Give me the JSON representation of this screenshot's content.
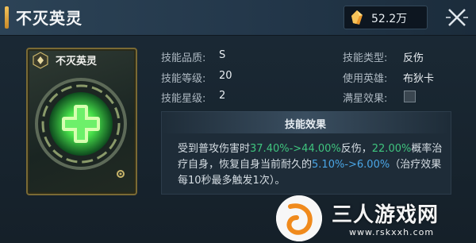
{
  "header": {
    "title": "不灭英灵",
    "currency_amount": "52.2万",
    "currency_icon": "crystal-shard-icon",
    "close_icon": "close-icon"
  },
  "card": {
    "title": "不灭英灵",
    "emblem_icon": "green-cross-shield-icon",
    "corner_icon": "skill-type-icon",
    "gear_icon": "gear-icon",
    "frame_color": "#7a6a34",
    "emblem_color": "#47e04a"
  },
  "info": {
    "quality_label": "技能品质:",
    "quality_value": "S",
    "level_label": "技能等级:",
    "level_value": "20",
    "star_label": "技能星级:",
    "star_value": "2",
    "type_label": "技能类型:",
    "type_value": "反伤",
    "hero_label": "使用英雄:",
    "hero_value": "布狄卡",
    "fullstar_label": "满星效果:"
  },
  "effect": {
    "title": "技能效果",
    "line1_a": "受到普攻伤害时",
    "line1_b": "37.40%->44.00%",
    "line1_c": "反伤，",
    "line1_d": "22.00%",
    "line1_e": "概率治",
    "line2_a": "疗自身，恢复自身当前耐久的",
    "line2_b": "5.10%->6.00%",
    "line2_c": "（治疗效果",
    "line3": "每10秒最多触发1次）。"
  },
  "watermark": {
    "text": "三人游戏网",
    "url": "www.rskxxh.com"
  },
  "colors": {
    "green_value": "#3fc47e",
    "blue_value": "#4aa6e6",
    "accent": "#f2c25a"
  }
}
